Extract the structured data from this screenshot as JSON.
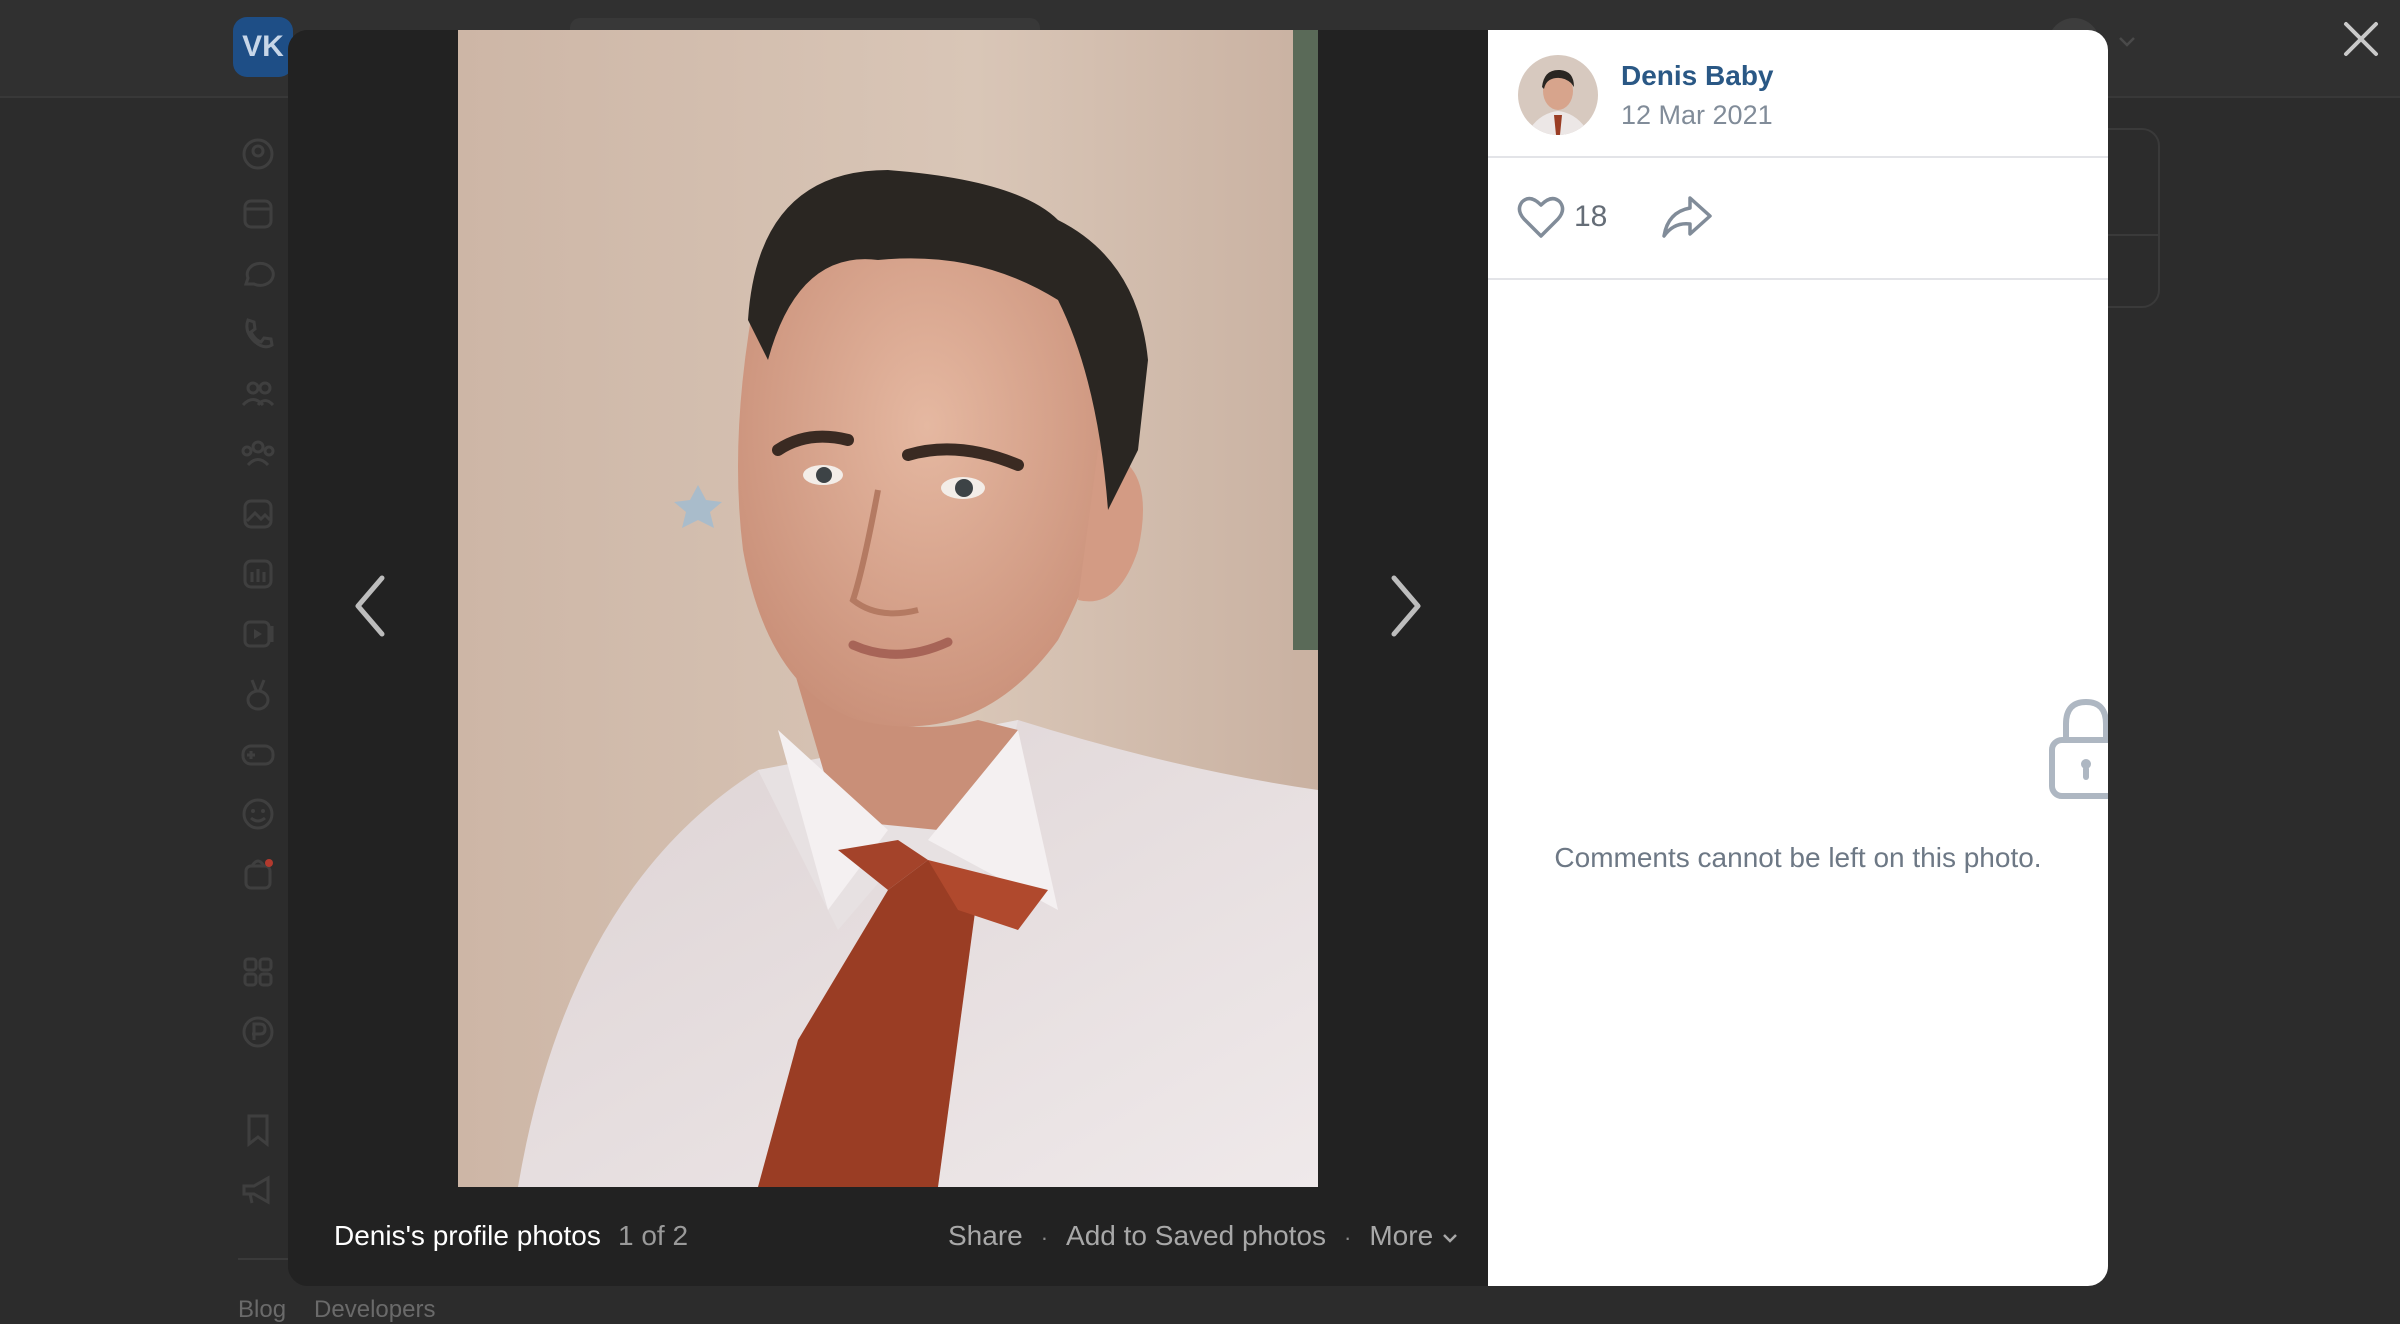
{
  "background": {
    "logo_text": "VK",
    "footer_links": [
      "Blog",
      "Developers"
    ]
  },
  "photo_viewer": {
    "album_title": "Denis's profile photos",
    "counter": "1 of 2",
    "actions": {
      "share": "Share",
      "add_saved": "Add to Saved photos",
      "more": "More"
    },
    "separator": "·"
  },
  "side_panel": {
    "author_name": "Denis Baby",
    "date": "12 Mar 2021",
    "likes": "18",
    "comments_notice": "Comments cannot be left on this photo."
  },
  "colors": {
    "link": "#2a5885",
    "muted": "#818c99",
    "overlay": "#2c2c2c"
  }
}
